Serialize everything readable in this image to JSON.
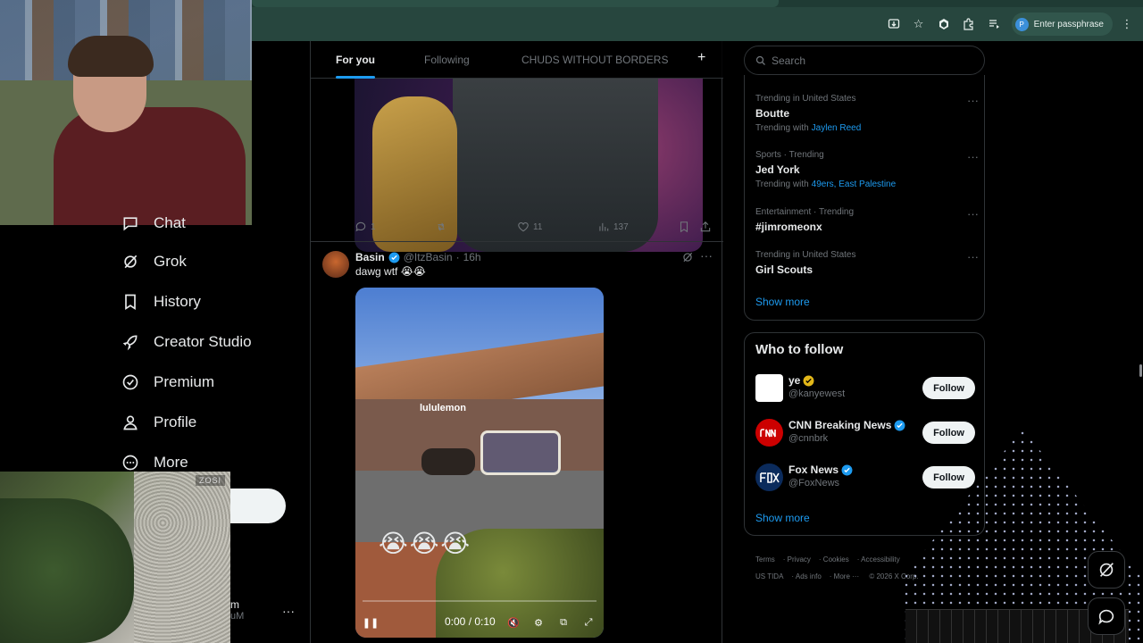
{
  "browser": {
    "profile_label": "Enter passphrase",
    "profile_initial": "P"
  },
  "nav": {
    "items": [
      {
        "label": "Chat",
        "icon": "chat-icon"
      },
      {
        "label": "Grok",
        "icon": "grok-icon"
      },
      {
        "label": "History",
        "icon": "bookmark-icon"
      },
      {
        "label": "Creator Studio",
        "icon": "rocket-icon"
      },
      {
        "label": "Premium",
        "icon": "verified-icon"
      },
      {
        "label": "Profile",
        "icon": "person-icon"
      },
      {
        "label": "More",
        "icon": "more-circle-icon"
      }
    ],
    "account_name": "m",
    "account_handle": "uM"
  },
  "cctv_logo": "ZOSI",
  "feed": {
    "tabs": [
      {
        "label": "For you",
        "active": true
      },
      {
        "label": "Following",
        "active": false
      },
      {
        "label": "CHUDS WITHOUT BORDERS",
        "active": false
      }
    ],
    "add_tab": "+",
    "tweet1": {
      "replies": "1",
      "likes": "11",
      "views": "137"
    },
    "tweet2": {
      "name": "Basin",
      "handle": "@ItzBasin",
      "time": "16h",
      "text": "dawg wtf 😭😭",
      "video_sign": "lululemon",
      "video_emoji": "😭😭😭",
      "video_time": "0:00 / 0:10"
    }
  },
  "sidebar": {
    "search_placeholder": "Search",
    "trends": [
      {
        "context": "Trending in United States",
        "topic": "Boutte",
        "with_label": "Trending with",
        "with": "Jaylen Reed"
      },
      {
        "context": "Sports · Trending",
        "topic": "Jed York",
        "with_label": "Trending with",
        "with": "49ers, East Palestine"
      },
      {
        "context": "Entertainment · Trending",
        "topic": "#jimromeonx",
        "with_label": "",
        "with": ""
      },
      {
        "context": "Trending in United States",
        "topic": "Girl Scouts",
        "with_label": "",
        "with": ""
      }
    ],
    "show_more": "Show more",
    "who_to_follow": {
      "title": "Who to follow",
      "accounts": [
        {
          "name": "ye",
          "handle": "@kanyewest",
          "badge": "gold",
          "follow": "Follow"
        },
        {
          "name": "CNN Breaking News",
          "handle": "@cnnbrk",
          "badge": "blue",
          "follow": "Follow"
        },
        {
          "name": "Fox News",
          "handle": "@FoxNews",
          "badge": "blue",
          "follow": "Follow"
        }
      ],
      "show_more": "Show more"
    },
    "footer": [
      "Terms",
      "Privacy",
      "Cookies",
      "Accessibility",
      "US TIDA",
      "Ads info",
      "More ···",
      "© 2026 X Corp."
    ]
  },
  "colors": {
    "accent": "#1d9bf0",
    "background": "#000000",
    "chrome": "#27463e"
  }
}
